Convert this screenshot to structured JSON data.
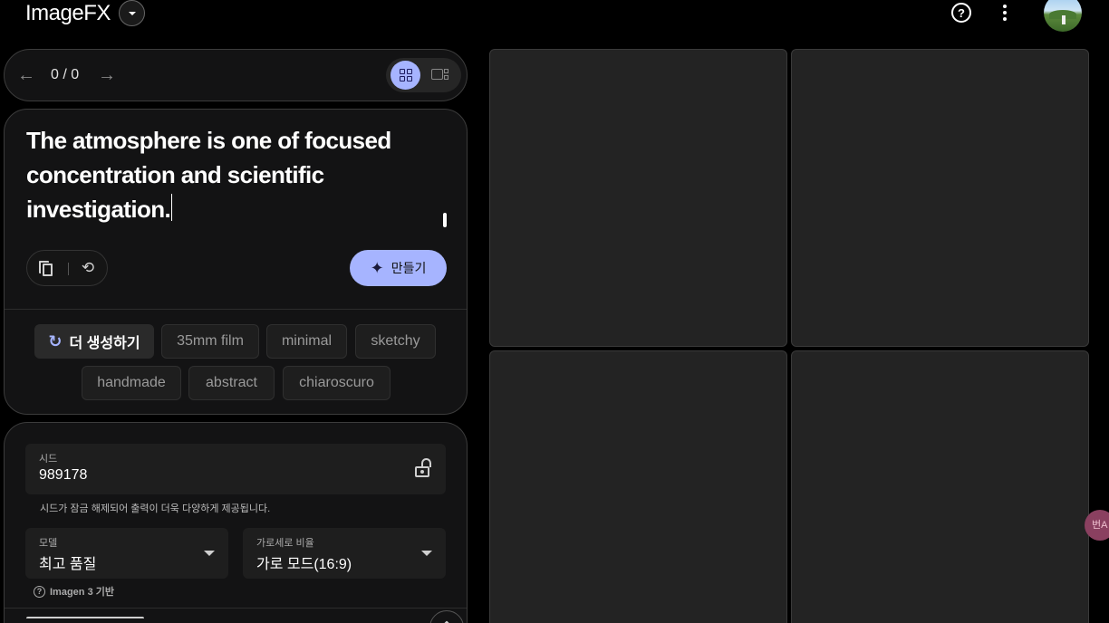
{
  "header": {
    "app_title": "ImageFX",
    "help_icon": "help-circle-icon",
    "more_icon": "more-vert-icon"
  },
  "navigator": {
    "counter": "0 / 0",
    "back_icon": "arrow-left-icon",
    "forward_icon": "arrow-right-icon",
    "view_modes": [
      "grid-view-icon",
      "single-view-icon"
    ],
    "active_view": "grid"
  },
  "prompt": {
    "text": "The atmosphere is one of focused concentration and scientific investigation.",
    "create_label": "만들기",
    "copy_icon": "copy-icon",
    "reset_icon": "reset-icon"
  },
  "chips": {
    "more_label": "더 생성하기",
    "items": [
      "35mm film",
      "minimal",
      "sketchy",
      "handmade",
      "abstract",
      "chiaroscuro"
    ]
  },
  "settings": {
    "seed_label": "시드",
    "seed_value": "989178",
    "seed_hint": "시드가 잠금 해제되어 출력이 더욱 다양하게 제공됩니다.",
    "model_label": "모델",
    "model_value": "최고 품질",
    "ratio_label": "가로세로 비율",
    "ratio_value": "가로 모드(16:9)",
    "model_note": "Imagen 3 기반"
  },
  "translate_fab": "번A",
  "colors": {
    "accent": "#a6b4ff",
    "panel_bg": "#131314",
    "tile_bg": "#232323"
  }
}
